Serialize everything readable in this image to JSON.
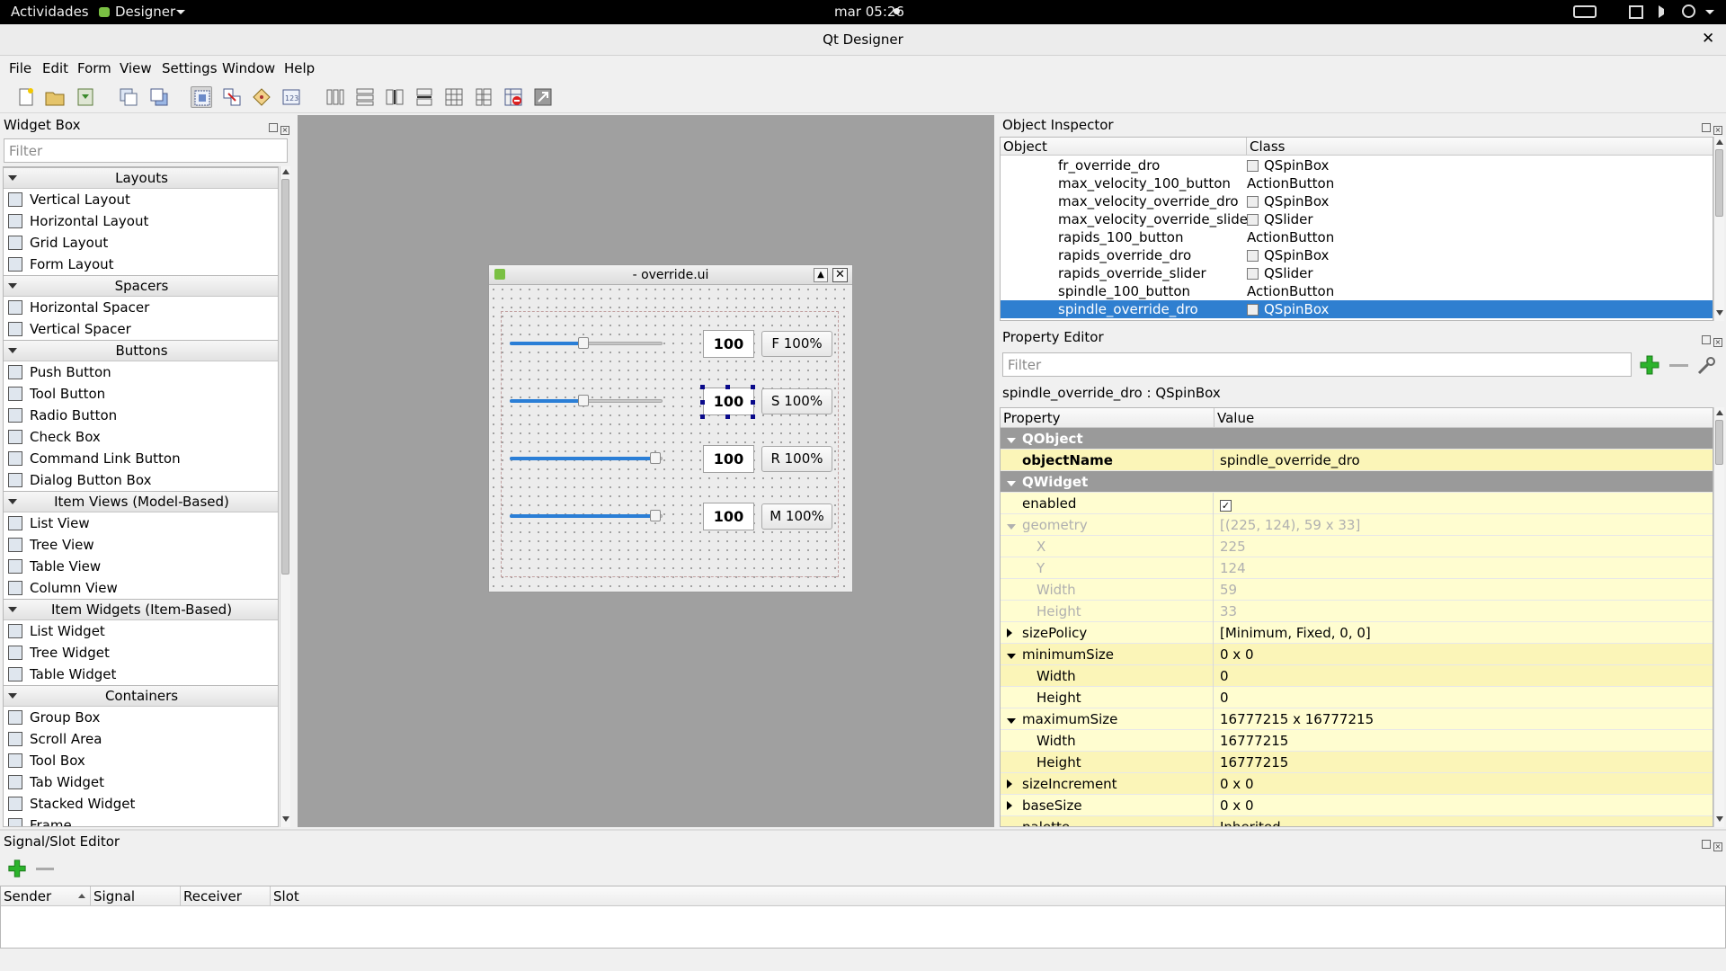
{
  "topbar": {
    "activities": "Actividades",
    "app": "Designer",
    "clock": "mar 05:26"
  },
  "window": {
    "title": "Qt Designer"
  },
  "menu": [
    "File",
    "Edit",
    "Form",
    "View",
    "Settings",
    "Window",
    "Help"
  ],
  "widget_box": {
    "title": "Widget Box",
    "filter_placeholder": "Filter",
    "categories": [
      {
        "name": "Layouts",
        "items": [
          "Vertical Layout",
          "Horizontal Layout",
          "Grid Layout",
          "Form Layout"
        ]
      },
      {
        "name": "Spacers",
        "items": [
          "Horizontal Spacer",
          "Vertical Spacer"
        ]
      },
      {
        "name": "Buttons",
        "items": [
          "Push Button",
          "Tool Button",
          "Radio Button",
          "Check Box",
          "Command Link Button",
          "Dialog Button Box"
        ]
      },
      {
        "name": "Item Views (Model-Based)",
        "items": [
          "List View",
          "Tree View",
          "Table View",
          "Column View"
        ]
      },
      {
        "name": "Item Widgets (Item-Based)",
        "items": [
          "List Widget",
          "Tree Widget",
          "Table Widget"
        ]
      },
      {
        "name": "Containers",
        "items": [
          "Group Box",
          "Scroll Area",
          "Tool Box",
          "Tab Widget",
          "Stacked Widget",
          "Frame"
        ]
      }
    ]
  },
  "form": {
    "title": "- override.ui",
    "rows": [
      {
        "value": "100",
        "button": "F 100%",
        "slider_fraction": 0.5
      },
      {
        "value": "100",
        "button": "S 100%",
        "slider_fraction": 0.5
      },
      {
        "value": "100",
        "button": "R 100%",
        "slider_fraction": 1.0
      },
      {
        "value": "100",
        "button": "M 100%",
        "slider_fraction": 1.0
      }
    ]
  },
  "object_inspector": {
    "title": "Object Inspector",
    "col_object": "Object",
    "col_class": "Class",
    "rows": [
      {
        "object": "fr_override_dro",
        "class": "QSpinBox"
      },
      {
        "object": "max_velocity_100_button",
        "class": "ActionButton"
      },
      {
        "object": "max_velocity_override_dro",
        "class": "QSpinBox"
      },
      {
        "object": "max_velocity_override_slider",
        "class": "QSlider"
      },
      {
        "object": "rapids_100_button",
        "class": "ActionButton"
      },
      {
        "object": "rapids_override_dro",
        "class": "QSpinBox"
      },
      {
        "object": "rapids_override_slider",
        "class": "QSlider"
      },
      {
        "object": "spindle_100_button",
        "class": "ActionButton"
      },
      {
        "object": "spindle_override_dro",
        "class": "QSpinBox"
      }
    ]
  },
  "property_editor": {
    "title": "Property Editor",
    "filter_placeholder": "Filter",
    "context": "spindle_override_dro : QSpinBox",
    "col_property": "Property",
    "col_value": "Value",
    "rows": [
      {
        "name": "QObject",
        "value": "",
        "kind": "group"
      },
      {
        "name": "objectName",
        "value": "spindle_override_dro",
        "kind": "bold"
      },
      {
        "name": "QWidget",
        "value": "",
        "kind": "group"
      },
      {
        "name": "enabled",
        "value": "✓",
        "kind": "y"
      },
      {
        "name": "geometry",
        "value": "[(225, 124), 59 x 33]",
        "kind": "dis"
      },
      {
        "name": "X",
        "value": "225",
        "kind": "dis-sub"
      },
      {
        "name": "Y",
        "value": "124",
        "kind": "dis-sub"
      },
      {
        "name": "Width",
        "value": "59",
        "kind": "dis-sub"
      },
      {
        "name": "Height",
        "value": "33",
        "kind": "dis-sub"
      },
      {
        "name": "sizePolicy",
        "value": "[Minimum, Fixed, 0, 0]",
        "kind": "closed"
      },
      {
        "name": "minimumSize",
        "value": "0 x 0",
        "kind": "open"
      },
      {
        "name": "Width",
        "value": "0",
        "kind": "sub"
      },
      {
        "name": "Height",
        "value": "0",
        "kind": "sub"
      },
      {
        "name": "maximumSize",
        "value": "16777215 x 16777215",
        "kind": "open"
      },
      {
        "name": "Width",
        "value": "16777215",
        "kind": "sub"
      },
      {
        "name": "Height",
        "value": "16777215",
        "kind": "sub"
      },
      {
        "name": "sizeIncrement",
        "value": "0 x 0",
        "kind": "closed"
      },
      {
        "name": "baseSize",
        "value": "0 x 0",
        "kind": "closed"
      },
      {
        "name": "palette",
        "value": "Inherited",
        "kind": "y"
      }
    ]
  },
  "signal_slot": {
    "title": "Signal/Slot Editor",
    "columns": [
      "Sender",
      "Signal",
      "Receiver",
      "Slot"
    ]
  },
  "colors": {
    "selection": "#2f7fd0",
    "canvas": "#a0a0a0",
    "slider_fill": "#2a7ed6",
    "property_yellow": "#fffdd0"
  }
}
